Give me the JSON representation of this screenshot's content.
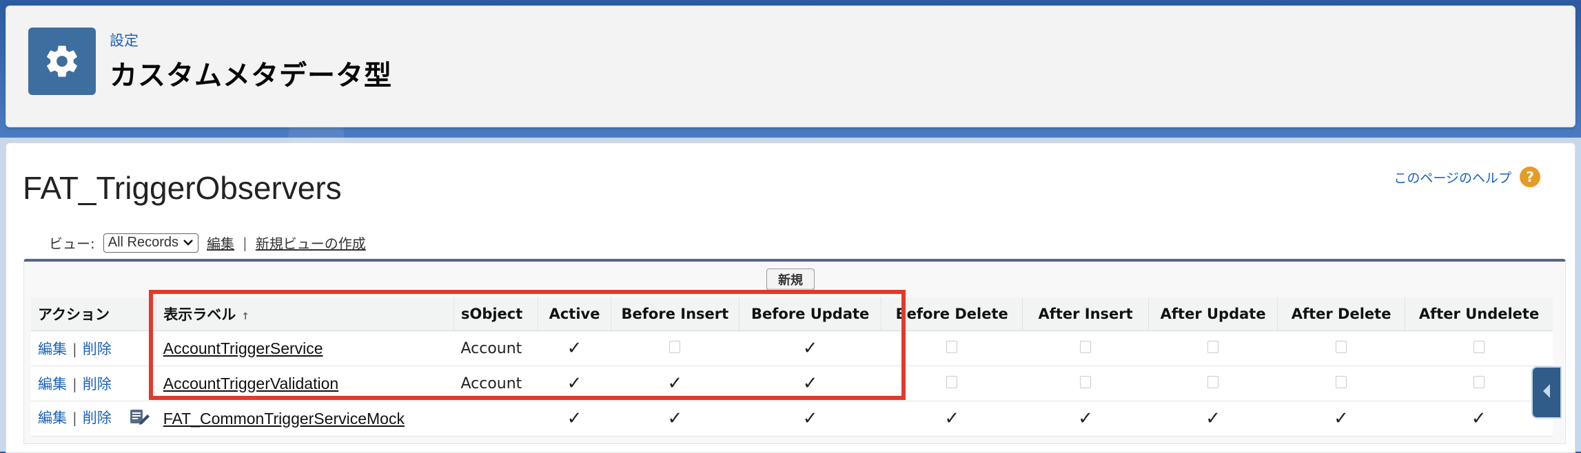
{
  "header": {
    "subtitle": "設定",
    "title": "カスタムメタデータ型"
  },
  "page": {
    "title": "FAT_TriggerObservers",
    "help_link": "このページのヘルプ",
    "help_icon_glyph": "?"
  },
  "view": {
    "label": "ビュー:",
    "selected": "All Records",
    "edit_link": "編集",
    "separator": "|",
    "new_view_link": "新規ビューの作成"
  },
  "table": {
    "new_button": "新規",
    "columns": [
      "アクション",
      "表示ラベル",
      "sObject",
      "Active",
      "Before Insert",
      "Before Update",
      "Before Delete",
      "After Insert",
      "After Update",
      "After Delete",
      "After Undelete"
    ],
    "actions": {
      "edit": "編集",
      "sep": "|",
      "delete": "削除"
    },
    "rows": [
      {
        "label": "AccountTriggerService",
        "sobject": "Account",
        "checks": [
          true,
          false,
          true,
          false,
          false,
          false,
          false,
          false
        ],
        "has_icon": false
      },
      {
        "label": "AccountTriggerValidation",
        "sobject": "Account",
        "checks": [
          true,
          true,
          true,
          false,
          false,
          false,
          false,
          false
        ],
        "has_icon": false
      },
      {
        "label": "FAT_CommonTriggerServiceMock",
        "sobject": "",
        "checks": [
          true,
          true,
          true,
          true,
          true,
          true,
          true,
          true
        ],
        "has_icon": true
      }
    ],
    "check_glyph": "✓"
  },
  "colors": {
    "highlight": "#e3392b",
    "link": "#1a62b8",
    "header_icon_bg": "#3e6ea0",
    "table_accent": "#56658b"
  },
  "icons": {
    "header": "gear-icon",
    "help": "help-icon",
    "sort": "sort-asc-icon",
    "row_edit": "edit-record-icon",
    "side_tab": "chevron-left-icon"
  }
}
